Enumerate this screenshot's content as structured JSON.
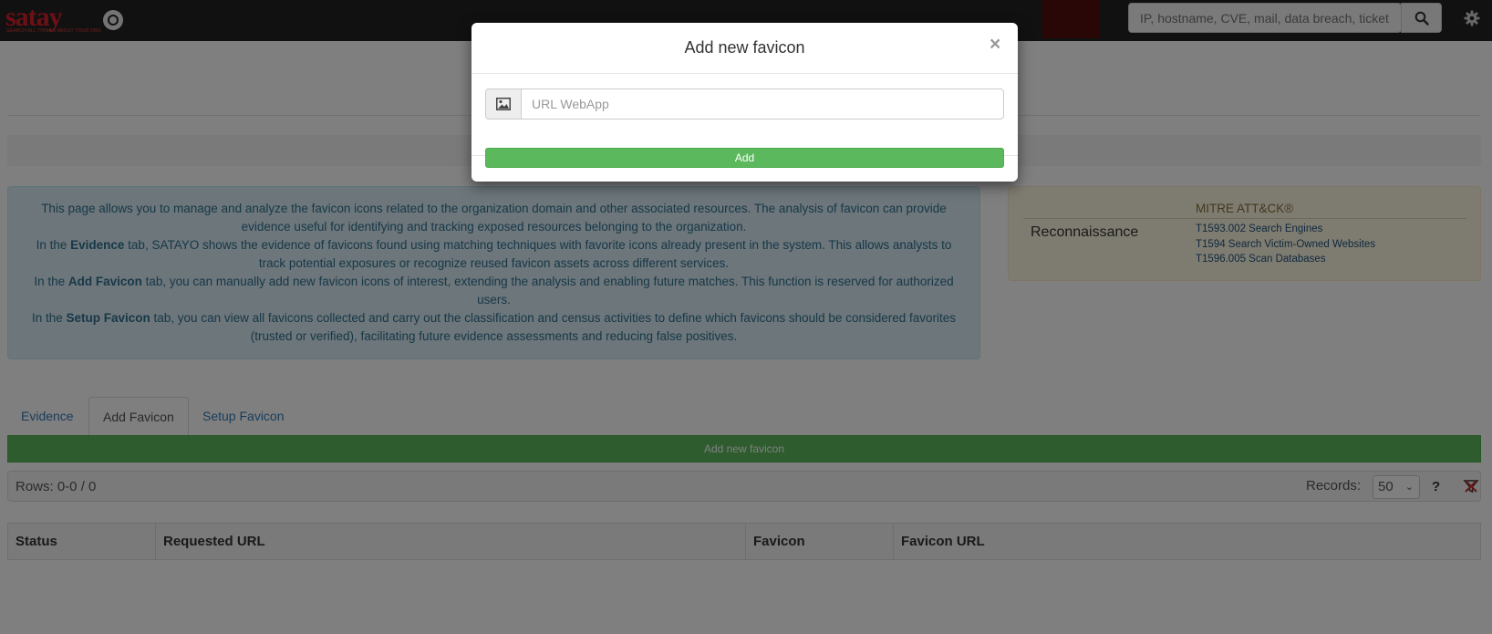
{
  "navbar": {
    "logo_text": "satay",
    "logo_tagline": "SEARCH ALL THINGS ABOUT YOUR ORG",
    "search_placeholder": "IP, hostname, CVE, mail, data breach, ticket",
    "icons": {
      "search": "search-icon",
      "settings": "gear-icon"
    }
  },
  "info": {
    "p1": "This page allows you to manage and analyze the favicon icons related to the organization domain and other associated resources. The analysis of favicon can provide evidence useful for identifying and tracking exposed resources belonging to the organization.",
    "p2_pre": "In the ",
    "p2_bold": "Evidence",
    "p2_post": " tab, SATAYO shows the evidence of favicons found using matching techniques with favorite icons already present in the system. This allows analysts to track potential exposures or recognize reused favicon assets across different services.",
    "p3_pre": "In the ",
    "p3_bold": "Add Favicon",
    "p3_post": " tab, you can manually add new favicon icons of interest, extending the analysis and enabling future matches. This function is reserved for authorized users.",
    "p4_pre": "In the ",
    "p4_bold": "Setup Favicon",
    "p4_post": " tab, you can view all favicons collected and carry out the classification and census activities to define which favicons should be considered favorites (trusted or verified), facilitating future evidence assessments and reducing false positives."
  },
  "mitre": {
    "title": "MITRE ATT&CK®",
    "tactic": "Reconnaissance",
    "techniques": [
      "T1593.002 Search Engines",
      "T1594 Search Victim-Owned Websites",
      "T1596.005 Scan Databases"
    ]
  },
  "tabs": [
    {
      "label": "Evidence"
    },
    {
      "label": "Add Favicon"
    },
    {
      "label": "Setup Favicon"
    }
  ],
  "add_bar_label": "Add new favicon",
  "rows_panel": {
    "rows_text": "Rows: 0-0 / 0",
    "records_label": "Records:",
    "records_value": "50",
    "help": "?"
  },
  "table": {
    "columns": [
      "Status",
      "Requested URL",
      "Favicon",
      "Favicon URL"
    ]
  },
  "modal": {
    "title": "Add new favicon",
    "close": "×",
    "url_placeholder": "URL WebApp",
    "add_label": "Add",
    "icons": {
      "addon": "image-icon"
    }
  },
  "colors": {
    "brand_red": "#d8202a",
    "success": "#5cb85c",
    "info_bg": "#d9edf7",
    "warning_bg": "#fcf8e3",
    "navbar": "#222222"
  }
}
